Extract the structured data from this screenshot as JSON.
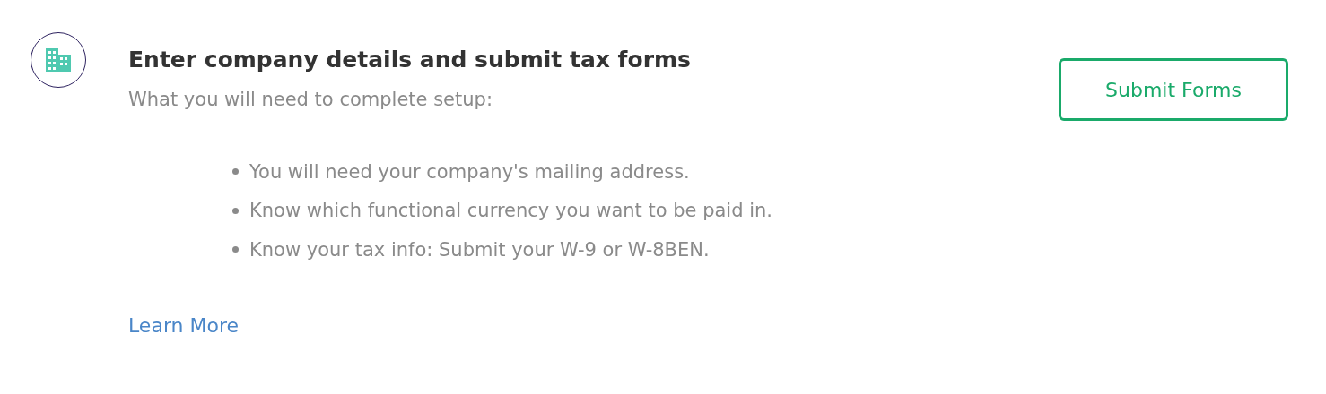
{
  "title": "Enter company details and submit tax forms",
  "subtitle": "What you will need to complete setup:",
  "requirements": [
    "You will need your company's mailing address.",
    "Know which functional currency you want to be paid in.",
    "Know your tax info: Submit your W-9 or W-8BEN."
  ],
  "link": "Learn More",
  "button": "Submit Forms"
}
